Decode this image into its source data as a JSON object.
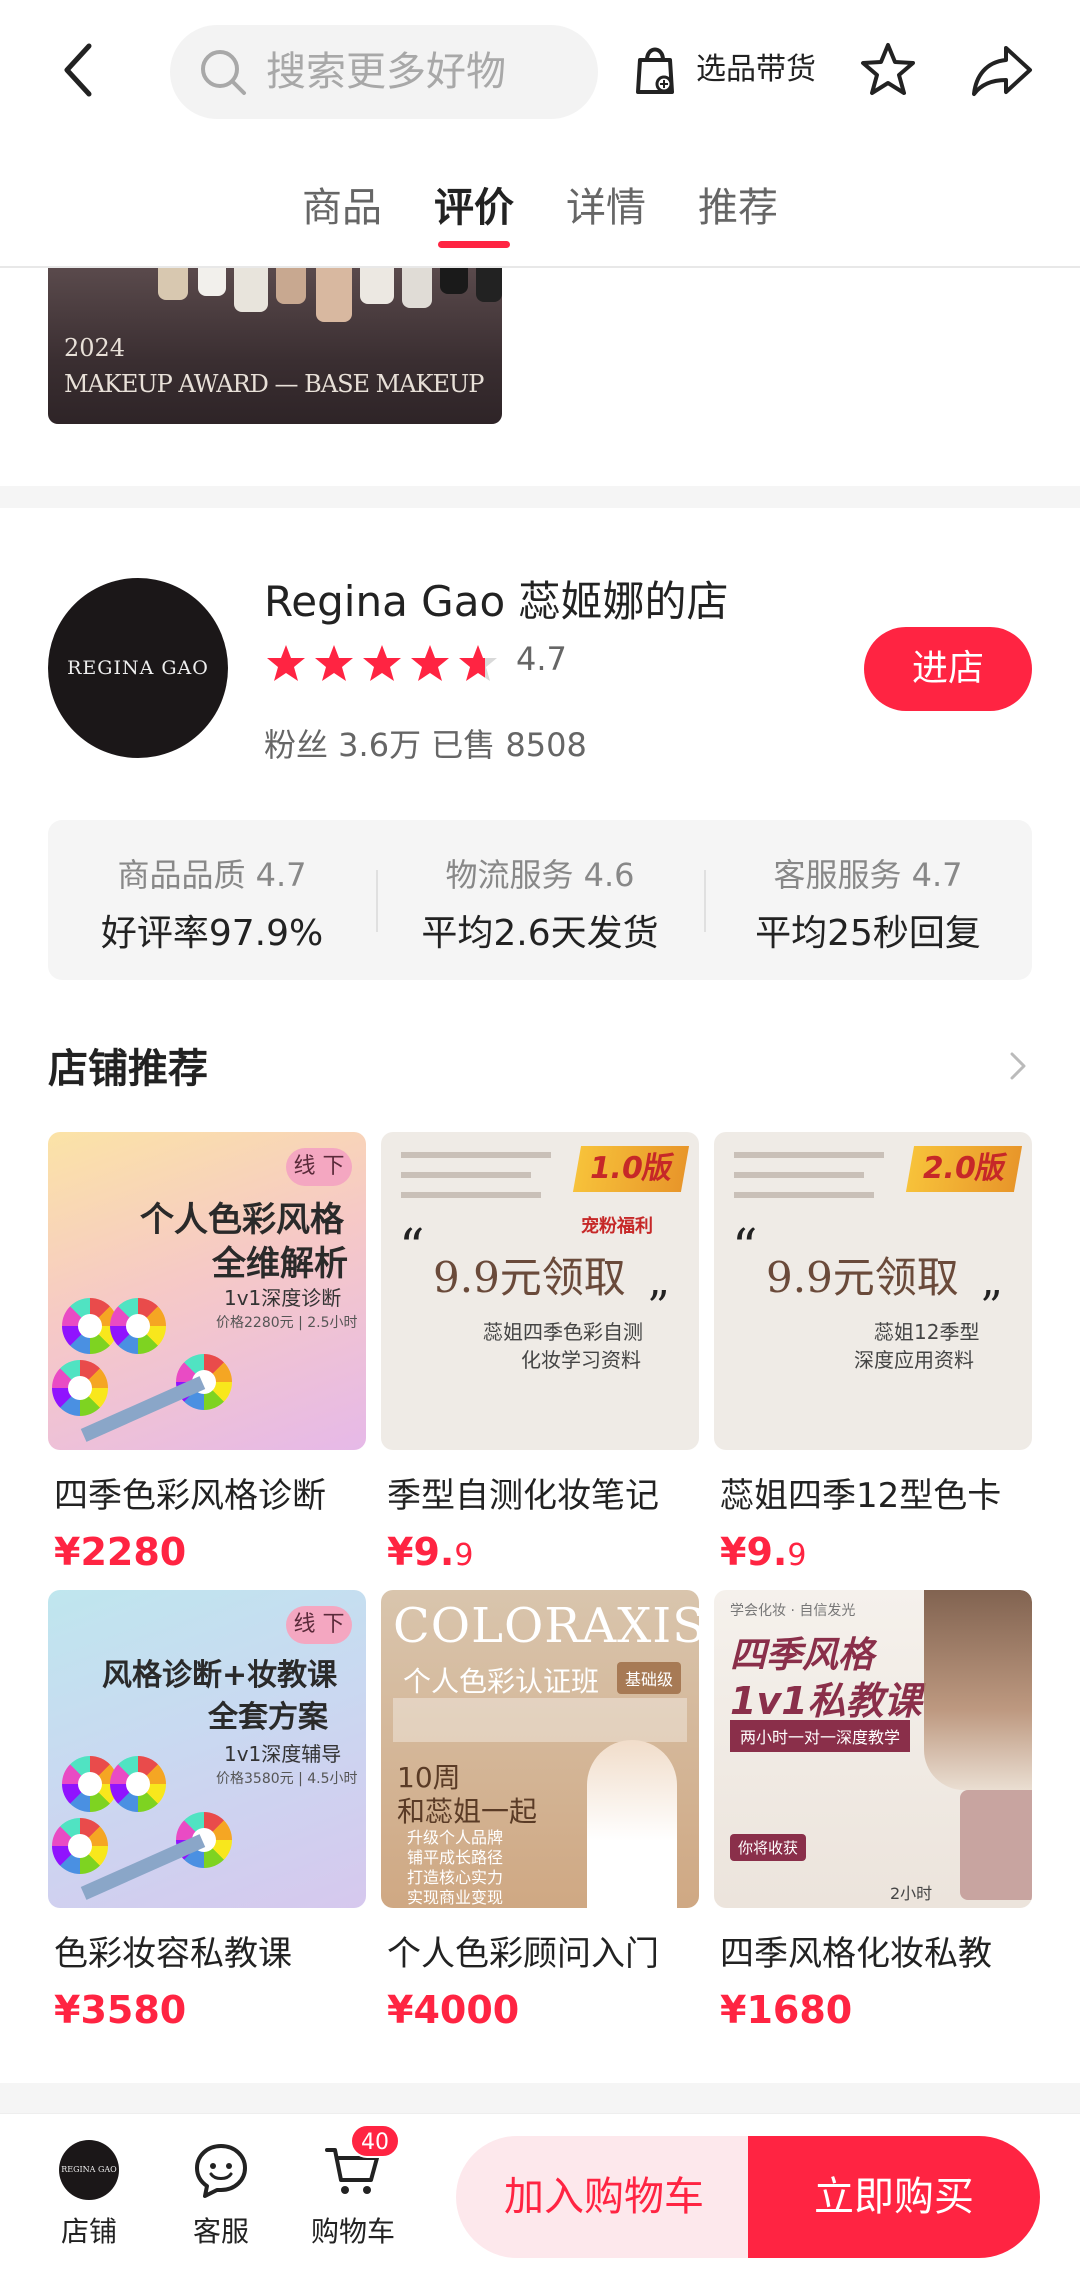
{
  "header": {
    "search_placeholder": "搜索更多好物",
    "select_label": "选品带货"
  },
  "tabs": [
    {
      "label": "商品"
    },
    {
      "label": "评价"
    },
    {
      "label": "详情"
    },
    {
      "label": "推荐"
    }
  ],
  "award": {
    "year": "2024",
    "caption": "MAKEUP AWARD — BASE MAKEUP"
  },
  "shop": {
    "logo_text": "REGINA GAO",
    "name": "Regina Gao 蕊姬娜的店",
    "rating": "4.7",
    "rating_value": 4.7,
    "stats": "粉丝 3.6万  已售 8508",
    "enter_label": "进店",
    "metrics": [
      {
        "title": "商品品质 4.7",
        "value": "好评率97.9%"
      },
      {
        "title": "物流服务 4.6",
        "value": "平均2.6天发货"
      },
      {
        "title": "客服服务 4.7",
        "value": "平均25秒回复"
      }
    ]
  },
  "recommend": {
    "title": "店铺推荐",
    "items": [
      {
        "name": "四季色彩风格诊断",
        "price": "¥2280",
        "thumb": {
          "badge": "线 下",
          "line1": "个人色彩风格",
          "line2": "全维解析",
          "line3": "1v1深度诊断",
          "line4": "价格2280元 | 2.5小时"
        }
      },
      {
        "name": "季型自测化妆笔记",
        "price_main": "¥9.",
        "price_small": "9",
        "thumb": {
          "version": "1.0版",
          "tag": "宠粉福利",
          "headline": "9.9元领取",
          "line1": "蕊姐四季色彩自测",
          "line2": "化妆学习资料"
        }
      },
      {
        "name": "蕊姐四季12型色卡",
        "price_main": "¥9.",
        "price_small": "9",
        "thumb": {
          "version": "2.0版",
          "headline": "9.9元领取",
          "line1": "蕊姐12季型",
          "line2": "深度应用资料"
        }
      },
      {
        "name": "色彩妆容私教课",
        "price": "¥3580",
        "thumb": {
          "badge": "线 下",
          "line1": "风格诊断+妆教课",
          "line2": "全套方案",
          "line3": "1v1深度辅导",
          "line4": "价格3580元 | 4.5小时"
        }
      },
      {
        "name": "个人色彩顾问入门",
        "price": "¥4000",
        "thumb": {
          "brand": "COLORAXIS",
          "line1": "个人色彩认证班",
          "level": "基础级",
          "line2": "10周",
          "line3": "和蕊姐一起",
          "bullets": [
            "升级个人品牌",
            "铺平成长路径",
            "打造核心实力",
            "实现商业变现"
          ]
        }
      },
      {
        "name": "四季风格化妆私教",
        "price": "¥1680",
        "thumb": {
          "top": "学会化妆 · 自信发光",
          "line1": "四季风格",
          "line2": "1v1私教课",
          "line3": "两小时一对一深度教学",
          "tag": "你将收获",
          "duration": "2小时"
        }
      }
    ]
  },
  "bottom_bar": {
    "shop_label": "店铺",
    "service_label": "客服",
    "cart_label": "购物车",
    "cart_count": "40",
    "add_cart_label": "加入购物车",
    "buy_now_label": "立即购买"
  }
}
